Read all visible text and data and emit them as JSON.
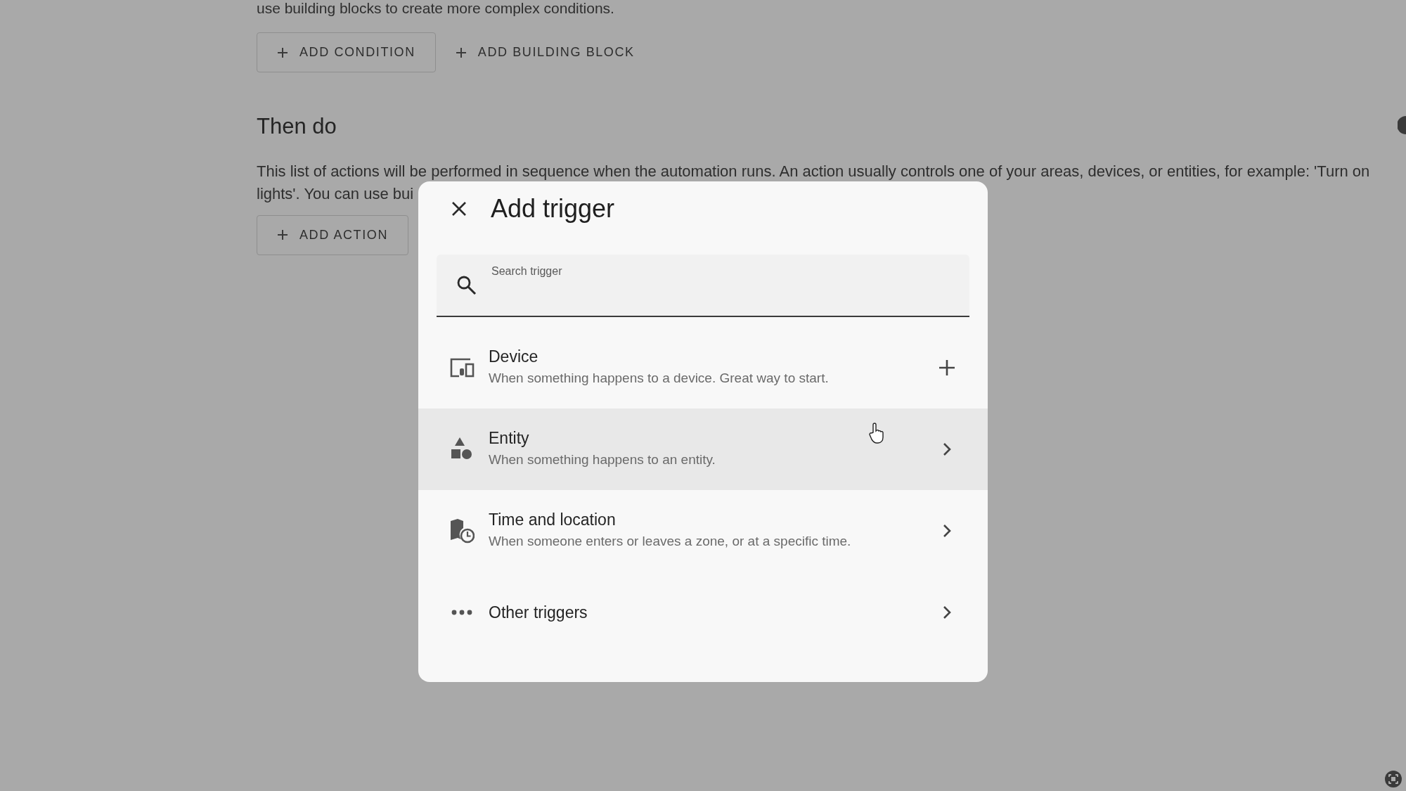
{
  "background": {
    "top_text": "use building blocks to create more complex conditions.",
    "condition_buttons": [
      "ADD CONDITION",
      "ADD BUILDING BLOCK"
    ],
    "section_title": "Then do",
    "paragraph_lines": [
      "This list of actions will be performed in sequence when the automation runs. An action usually controls one of your areas, devices, or entities, for example: 'Turn on",
      "lights'. You can use bui"
    ],
    "action_button": "ADD ACTION"
  },
  "dialog": {
    "title": "Add trigger",
    "search": {
      "placeholder": "Search trigger"
    },
    "items": [
      {
        "kind": "device",
        "title": "Device",
        "subtitle": "When something happens to a device. Great way to start.",
        "hovered": false
      },
      {
        "kind": "entity",
        "title": "Entity",
        "subtitle": "When something happens to an entity.",
        "hovered": true
      },
      {
        "kind": "time",
        "title": "Time and location",
        "subtitle": "When someone enters or leaves a zone, or at a specific time.",
        "hovered": false
      },
      {
        "kind": "other",
        "title": "Other triggers",
        "hovered": false
      }
    ]
  }
}
